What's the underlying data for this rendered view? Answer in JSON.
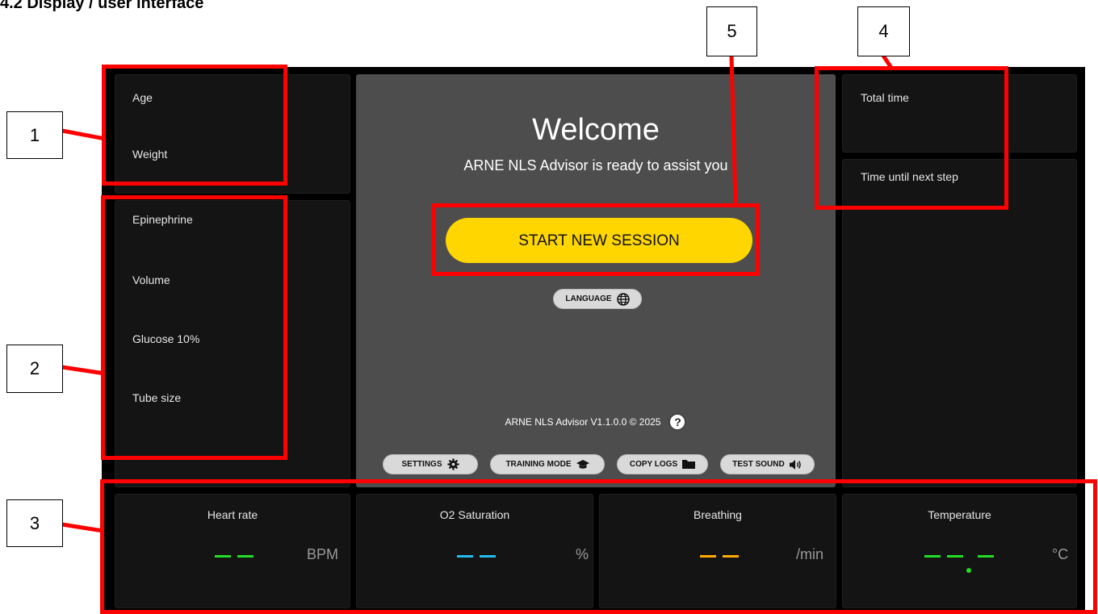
{
  "heading": "4.2 Display / user interface",
  "left_top": {
    "age_label": "Age",
    "weight_label": "Weight"
  },
  "left_meds": {
    "epinephrine_label": "Epinephrine",
    "volume_label": "Volume",
    "glucose_label": "Glucose 10%",
    "tube_label": "Tube size"
  },
  "center": {
    "welcome": "Welcome",
    "subtitle": "ARNE NLS Advisor is ready to assist you",
    "start_button": "START NEW SESSION",
    "language_button": "LANGUAGE",
    "version": "ARNE NLS Advisor V1.1.0.0 © 2025",
    "settings_button": "SETTINGS",
    "training_button": "TRAINING MODE",
    "copylogs_button": "COPY LOGS",
    "testsound_button": "TEST SOUND"
  },
  "right": {
    "total_time_label": "Total time",
    "next_step_label": "Time until next step"
  },
  "vitals": {
    "heart_rate": {
      "label": "Heart rate",
      "unit": "BPM",
      "color": "#22dd22"
    },
    "o2": {
      "label": "O2 Saturation",
      "unit": "%",
      "color": "#22bbee"
    },
    "breathing": {
      "label": "Breathing",
      "unit": "/min",
      "color": "#ffaa00"
    },
    "temperature": {
      "label": "Temperature",
      "unit": "°C",
      "color": "#22dd22"
    }
  },
  "callouts": [
    "1",
    "2",
    "3",
    "4",
    "5"
  ]
}
